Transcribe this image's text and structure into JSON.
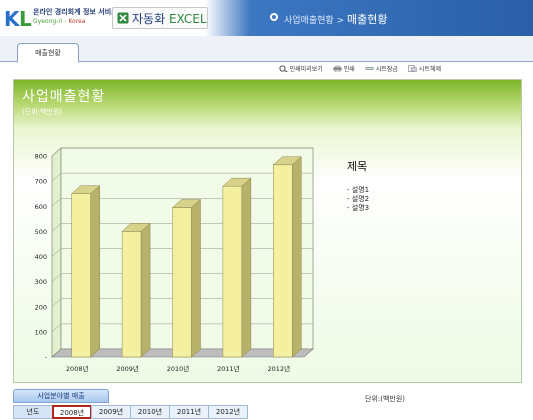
{
  "header": {
    "logo_text": "KL",
    "service_name": "온라인 경리회계 정보 서비스",
    "service_sub_prefix": "Gyeong-ri",
    "service_sub_suffix": "Korea",
    "module_title": "자동화",
    "module_title_suffix": "EXCEL",
    "breadcrumb_parent": "사업매출현황",
    "breadcrumb_sep": ">",
    "breadcrumb_current": "매출현황"
  },
  "tabs": [
    {
      "label": "매출현황",
      "active": true
    }
  ],
  "toolbar": {
    "items": [
      {
        "label": "인쇄미리보기",
        "icon": "print-preview-icon"
      },
      {
        "label": "인쇄",
        "icon": "printer-icon"
      },
      {
        "label": "시트잠금",
        "icon": "sheet-lock-icon"
      },
      {
        "label": "시트해제",
        "icon": "sheet-unlock-icon"
      }
    ]
  },
  "report": {
    "title": "사업매출현황",
    "unit": "(단위:백만원)",
    "legend_title": "제목",
    "legend_items": [
      "- 설명1",
      "- 설명2",
      "- 설명3"
    ]
  },
  "chart_data": {
    "type": "bar",
    "style": "3d-column",
    "categories": [
      "2008년",
      "2009년",
      "2010년",
      "2011년",
      "2012년"
    ],
    "values": [
      650,
      500,
      595,
      680,
      765
    ],
    "ylim": [
      0,
      800
    ],
    "yticks": [
      0,
      100,
      200,
      300,
      400,
      500,
      600,
      700,
      800
    ],
    "ytick_labels": [
      "-",
      "100",
      "200",
      "300",
      "400",
      "500",
      "600",
      "700",
      "800"
    ],
    "bar_color": "#f4f0a0",
    "grid": true,
    "legend_position": "right"
  },
  "section": {
    "tab_label": "사업분야별 매출",
    "unit": "단위:(백만원)",
    "row_header": "년도",
    "years": [
      "2008년",
      "2009년",
      "2010년",
      "2011년",
      "2012년"
    ],
    "selected_index": 0
  },
  "colors": {
    "banner_blue": "#2a5ea8",
    "panel_green": "#7ab52a",
    "selected_border": "#b3261e"
  }
}
